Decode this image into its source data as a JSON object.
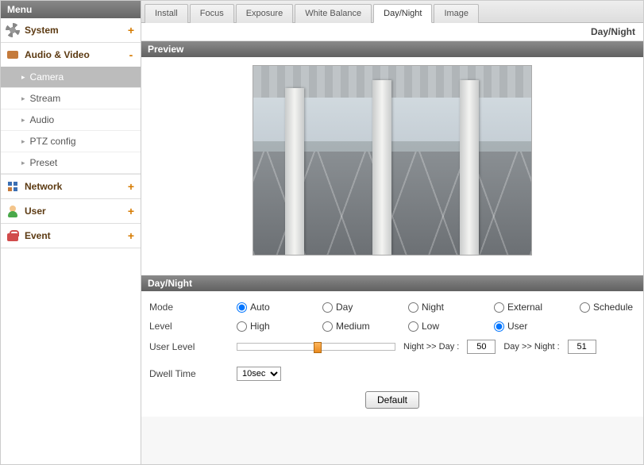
{
  "sidebar": {
    "title": "Menu",
    "groups": [
      {
        "key": "system",
        "label": "System",
        "icon": "gear-icon",
        "expanded": false,
        "sign": "+"
      },
      {
        "key": "av",
        "label": "Audio & Video",
        "icon": "camera-icon",
        "expanded": true,
        "sign": "-",
        "items": [
          {
            "key": "camera",
            "label": "Camera",
            "active": true
          },
          {
            "key": "stream",
            "label": "Stream",
            "active": false
          },
          {
            "key": "audio",
            "label": "Audio",
            "active": false
          },
          {
            "key": "ptz",
            "label": "PTZ config",
            "active": false
          },
          {
            "key": "preset",
            "label": "Preset",
            "active": false
          }
        ]
      },
      {
        "key": "network",
        "label": "Network",
        "icon": "network-icon",
        "expanded": false,
        "sign": "+"
      },
      {
        "key": "user",
        "label": "User",
        "icon": "user-icon",
        "expanded": false,
        "sign": "+"
      },
      {
        "key": "event",
        "label": "Event",
        "icon": "event-icon",
        "expanded": false,
        "sign": "+"
      }
    ]
  },
  "tabs": [
    {
      "key": "install",
      "label": "Install",
      "active": false
    },
    {
      "key": "focus",
      "label": "Focus",
      "active": false
    },
    {
      "key": "exposure",
      "label": "Exposure",
      "active": false
    },
    {
      "key": "wb",
      "label": "White Balance",
      "active": false
    },
    {
      "key": "daynight",
      "label": "Day/Night",
      "active": true
    },
    {
      "key": "image",
      "label": "Image",
      "active": false
    }
  ],
  "page": {
    "title": "Day/Night",
    "preview_header": "Preview",
    "section_header": "Day/Night"
  },
  "form": {
    "mode_label": "Mode",
    "mode_options": [
      "Auto",
      "Day",
      "Night",
      "External",
      "Schedule"
    ],
    "mode_selected": "Auto",
    "level_label": "Level",
    "level_options": [
      "High",
      "Medium",
      "Low",
      "User"
    ],
    "level_selected": "User",
    "userlevel_label": "User Level",
    "night_to_day_label": "Night >> Day :",
    "night_to_day_value": "50",
    "day_to_night_label": "Day >> Night :",
    "day_to_night_value": "51",
    "dwell_label": "Dwell Time",
    "dwell_value": "10sec",
    "default_button": "Default"
  }
}
